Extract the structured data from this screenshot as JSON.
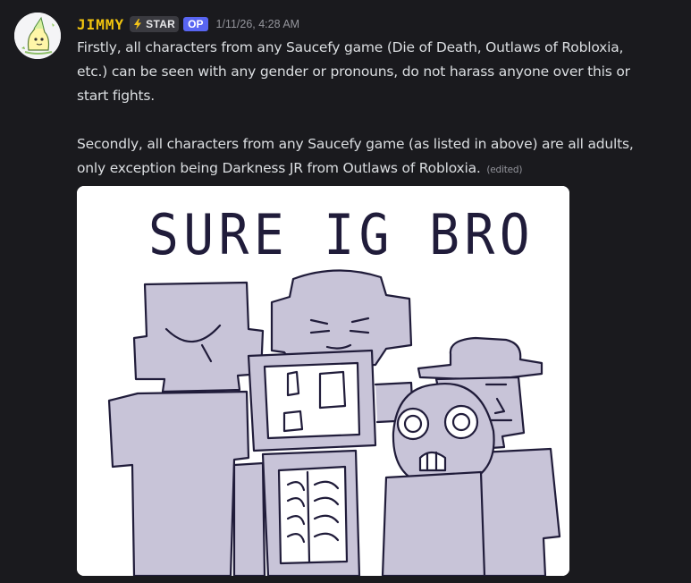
{
  "message": {
    "author": "JIMMY",
    "badge_label": "STAR",
    "op_label": "OP",
    "timestamp": "1/11/26, 4:28 AM",
    "paragraph_1": "Firstly, all characters from any Saucefy game (Die of Death, Outlaws of Robloxia, etc.) can be seen with any gender or pronouns, do not harass anyone over this or start fights.",
    "paragraph_2": "Secondly, all characters from any Saucefy game (as listed in above) are all adults, only exception being Darkness JR from Outlaws of Robloxia.",
    "edited_label": "(edited)",
    "image_caption_text": "SURE IG BRO"
  },
  "colors": {
    "username": "#f1c40f",
    "op_badge": "#5865f2",
    "background": "#1a1a1e",
    "text": "#dbdee1",
    "figure_fill": "#c8c4d8",
    "ink": "#201c3a"
  },
  "icons": {
    "badge": "lightning-bolt-icon",
    "avatar": "avatar-drawing-icon"
  }
}
